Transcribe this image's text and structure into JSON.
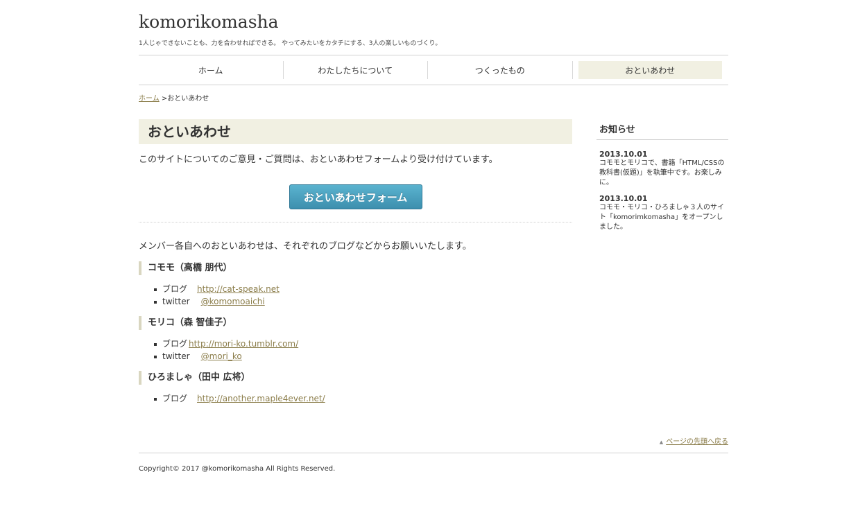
{
  "header": {
    "site_title": "komorikomasha",
    "tagline": "1人じゃできないことも、力を合わせればできる。 やってみたいをカタチにする、3人の楽しいものづくり。"
  },
  "nav": {
    "items": [
      {
        "label": "ホーム"
      },
      {
        "label": "わたしたちについて"
      },
      {
        "label": "つくったもの"
      },
      {
        "label": "おといあわせ",
        "current": true
      }
    ],
    "current_bg": "#f1f0e2"
  },
  "breadcrumb": {
    "home": "ホーム",
    "current": ">おといあわせ"
  },
  "main": {
    "heading": "おといあわせ",
    "intro": "このサイトについてのご意見・ご質問は、おといあわせフォームより受け付けています。",
    "form_button": "おといあわせフォーム",
    "members_intro": "メンバー各自へのおといあわせは、それぞれのブログなどからお願いいたします。",
    "members": [
      {
        "name": "コモモ（高橋 朋代）",
        "links": [
          {
            "label": "ブログ",
            "value": "http://cat-speak.net"
          },
          {
            "label": "twitter",
            "value": "@komomoaichi"
          }
        ]
      },
      {
        "name": "モリコ（森 智佳子）",
        "links": [
          {
            "label": "ブログ",
            "value": "http://mori-ko.tumblr.com/"
          },
          {
            "label": "twitter",
            "value": "@mori_ko"
          }
        ]
      },
      {
        "name": "ひろましゃ（田中 広将）",
        "links": [
          {
            "label": "ブログ",
            "value": "http://another.maple4ever.net/"
          }
        ]
      }
    ]
  },
  "sidebar": {
    "heading": "お知らせ",
    "news": [
      {
        "date": "2013.10.01",
        "text": "コモモとモリコで、書籍「HTML/CSSの教科書(仮題)」を執筆中です。お楽しみに。"
      },
      {
        "date": "2013.10.01",
        "text": "コモモ・モリコ・ひろましゃ３人のサイト「komorimkomasha」をオープンしました。"
      }
    ]
  },
  "footer": {
    "to_top": "ページの先頭へ戻る",
    "to_top_icon": "triangle-up-icon",
    "copyright": "Copyright© 2017 @komorikomasha All Rights Reserved."
  },
  "colors": {
    "accent_bg": "#f1f0e2",
    "link": "#8b7d4a",
    "button": "#4aa1c0"
  }
}
